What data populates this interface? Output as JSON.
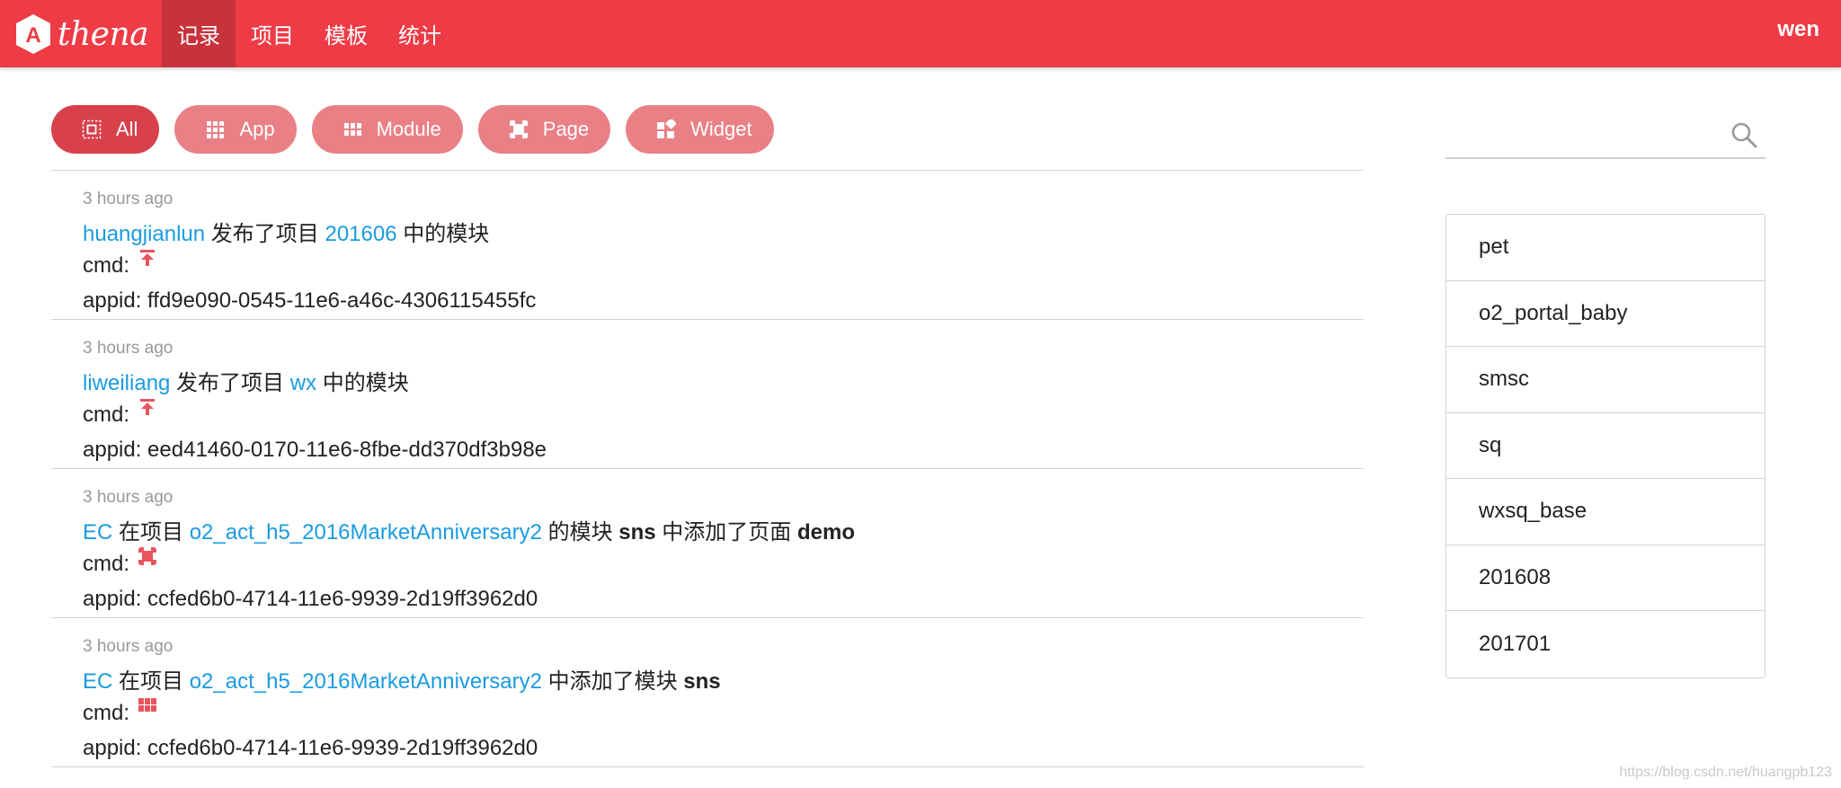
{
  "header": {
    "logo_letter": "A",
    "logo_text": "thena",
    "nav": [
      {
        "label": "记录",
        "active": true
      },
      {
        "label": "项目",
        "active": false
      },
      {
        "label": "模板",
        "active": false
      },
      {
        "label": "统计",
        "active": false
      }
    ],
    "user": "wen",
    "colors": {
      "bar": "#ee3b46",
      "active": "#c8323b"
    }
  },
  "filters": [
    {
      "label": "All",
      "icon": "all-icon",
      "active": true
    },
    {
      "label": "App",
      "icon": "app-grid-icon",
      "active": false
    },
    {
      "label": "Module",
      "icon": "module-icon",
      "active": false
    },
    {
      "label": "Page",
      "icon": "page-icon",
      "active": false
    },
    {
      "label": "Widget",
      "icon": "widget-icon",
      "active": false
    }
  ],
  "records": [
    {
      "time": "3 hours ago",
      "parts": [
        {
          "text": "huangjianlun",
          "style": "link"
        },
        {
          "text": " 发布了项目 ",
          "style": "plain"
        },
        {
          "text": "201606",
          "style": "link"
        },
        {
          "text": " 中的模块",
          "style": "plain"
        }
      ],
      "cmd_label": "cmd:",
      "cmd_icon": "publish-icon",
      "appid": "appid: ffd9e090-0545-11e6-a46c-4306115455fc"
    },
    {
      "time": "3 hours ago",
      "parts": [
        {
          "text": "liweiliang",
          "style": "link"
        },
        {
          "text": " 发布了项目 ",
          "style": "plain"
        },
        {
          "text": "wx",
          "style": "link"
        },
        {
          "text": " 中的模块",
          "style": "plain"
        }
      ],
      "cmd_label": "cmd:",
      "cmd_icon": "publish-icon",
      "appid": "appid: eed41460-0170-11e6-8fbe-dd370df3b98e"
    },
    {
      "time": "3 hours ago",
      "parts": [
        {
          "text": "EC",
          "style": "link"
        },
        {
          "text": " 在项目 ",
          "style": "plain"
        },
        {
          "text": "o2_act_h5_2016MarketAnniversary2",
          "style": "link"
        },
        {
          "text": " 的模块 ",
          "style": "plain"
        },
        {
          "text": "sns",
          "style": "bold"
        },
        {
          "text": " 中添加了页面 ",
          "style": "plain"
        },
        {
          "text": "demo",
          "style": "bold"
        }
      ],
      "cmd_label": "cmd:",
      "cmd_icon": "page-add-icon",
      "appid": "appid: ccfed6b0-4714-11e6-9939-2d19ff3962d0"
    },
    {
      "time": "3 hours ago",
      "parts": [
        {
          "text": "EC",
          "style": "link"
        },
        {
          "text": " 在项目 ",
          "style": "plain"
        },
        {
          "text": "o2_act_h5_2016MarketAnniversary2",
          "style": "link"
        },
        {
          "text": " 中添加了模块 ",
          "style": "plain"
        },
        {
          "text": "sns",
          "style": "bold"
        }
      ],
      "cmd_label": "cmd:",
      "cmd_icon": "module-add-icon",
      "appid": "appid: ccfed6b0-4714-11e6-9939-2d19ff3962d0"
    }
  ],
  "search": {
    "placeholder": ""
  },
  "projects": [
    "pet",
    "o2_portal_baby",
    "smsc",
    "sq",
    "wxsq_base",
    "201608",
    "201701"
  ],
  "watermark": "https://blog.csdn.net/huangpb123",
  "colors": {
    "link": "#1a9be0",
    "pill": "#e98086",
    "pill_active": "#d8414b",
    "icon": "#e8555e"
  }
}
